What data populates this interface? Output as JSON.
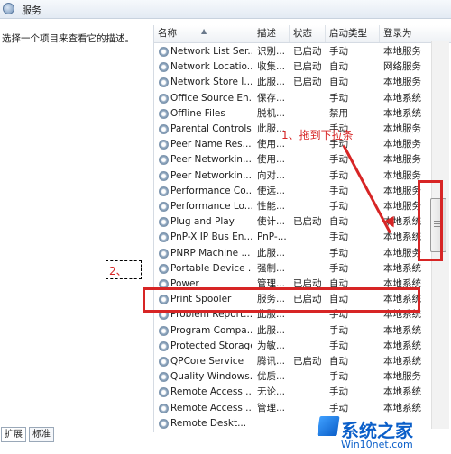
{
  "window": {
    "title": "服务"
  },
  "description_panel": {
    "text": "选择一个项目来查看它的描述。"
  },
  "columns": {
    "name": "名称",
    "description": "描述",
    "status": "状态",
    "startup": "启动类型",
    "logon": "登录为"
  },
  "services": [
    {
      "name": "Network List Ser...",
      "desc": "识别...",
      "status": "已启动",
      "startup": "手动",
      "logon": "本地服务"
    },
    {
      "name": "Network Locatio...",
      "desc": "收集...",
      "status": "已启动",
      "startup": "自动",
      "logon": "网络服务"
    },
    {
      "name": "Network Store I...",
      "desc": "此服...",
      "status": "已启动",
      "startup": "自动",
      "logon": "本地服务"
    },
    {
      "name": "Office Source En...",
      "desc": "保存...",
      "status": "",
      "startup": "手动",
      "logon": "本地系统"
    },
    {
      "name": "Offline Files",
      "desc": "脱机...",
      "status": "",
      "startup": "禁用",
      "logon": "本地系统"
    },
    {
      "name": "Parental Controls",
      "desc": "此服...",
      "status": "",
      "startup": "手动",
      "logon": "本地服务"
    },
    {
      "name": "Peer Name Res...",
      "desc": "使用...",
      "status": "",
      "startup": "手动",
      "logon": "本地服务"
    },
    {
      "name": "Peer Networkin...",
      "desc": "使用...",
      "status": "",
      "startup": "手动",
      "logon": "本地服务"
    },
    {
      "name": "Peer Networkin...",
      "desc": "向对...",
      "status": "",
      "startup": "手动",
      "logon": "本地服务"
    },
    {
      "name": "Performance Co...",
      "desc": "使远...",
      "status": "",
      "startup": "手动",
      "logon": "本地服务"
    },
    {
      "name": "Performance Lo...",
      "desc": "性能...",
      "status": "",
      "startup": "手动",
      "logon": "本地服务"
    },
    {
      "name": "Plug and Play",
      "desc": "使计...",
      "status": "已启动",
      "startup": "自动",
      "logon": "本地系统"
    },
    {
      "name": "PnP-X IP Bus En...",
      "desc": "PnP-...",
      "status": "",
      "startup": "手动",
      "logon": "本地系统"
    },
    {
      "name": "PNRP Machine ...",
      "desc": "此服...",
      "status": "",
      "startup": "手动",
      "logon": "本地服务"
    },
    {
      "name": "Portable Device ...",
      "desc": "强制...",
      "status": "",
      "startup": "手动",
      "logon": "本地系统"
    },
    {
      "name": "Power",
      "desc": "管理...",
      "status": "已启动",
      "startup": "自动",
      "logon": "本地系统"
    },
    {
      "name": "Print Spooler",
      "desc": "服务...",
      "status": "已启动",
      "startup": "自动",
      "logon": "本地系统"
    },
    {
      "name": "Problem Report...",
      "desc": "此服...",
      "status": "",
      "startup": "手动",
      "logon": "本地系统"
    },
    {
      "name": "Program Compa...",
      "desc": "此服...",
      "status": "",
      "startup": "手动",
      "logon": "本地系统"
    },
    {
      "name": "Protected Storage",
      "desc": "为敏...",
      "status": "",
      "startup": "手动",
      "logon": "本地系统"
    },
    {
      "name": "QPCore Service",
      "desc": "腾讯...",
      "status": "已启动",
      "startup": "自动",
      "logon": "本地系统"
    },
    {
      "name": "Quality Windows...",
      "desc": "优质...",
      "status": "",
      "startup": "手动",
      "logon": "本地服务"
    },
    {
      "name": "Remote Access ...",
      "desc": "无论...",
      "status": "",
      "startup": "手动",
      "logon": "本地系统"
    },
    {
      "name": "Remote Access ...",
      "desc": "管理...",
      "status": "",
      "startup": "手动",
      "logon": "本地系统"
    },
    {
      "name": "Remote Deskt...",
      "desc": "",
      "status": "",
      "startup": "",
      "logon": ""
    }
  ],
  "tabs": {
    "expand": "扩展",
    "standard": "标准"
  },
  "annotations": {
    "step1": "1、拖到下拉条",
    "step2": "2、"
  },
  "watermark": {
    "brand": "系统之家",
    "url": "Win10net.com"
  },
  "colors": {
    "annotation": "#d72525",
    "watermark": "#0b5fc9"
  }
}
